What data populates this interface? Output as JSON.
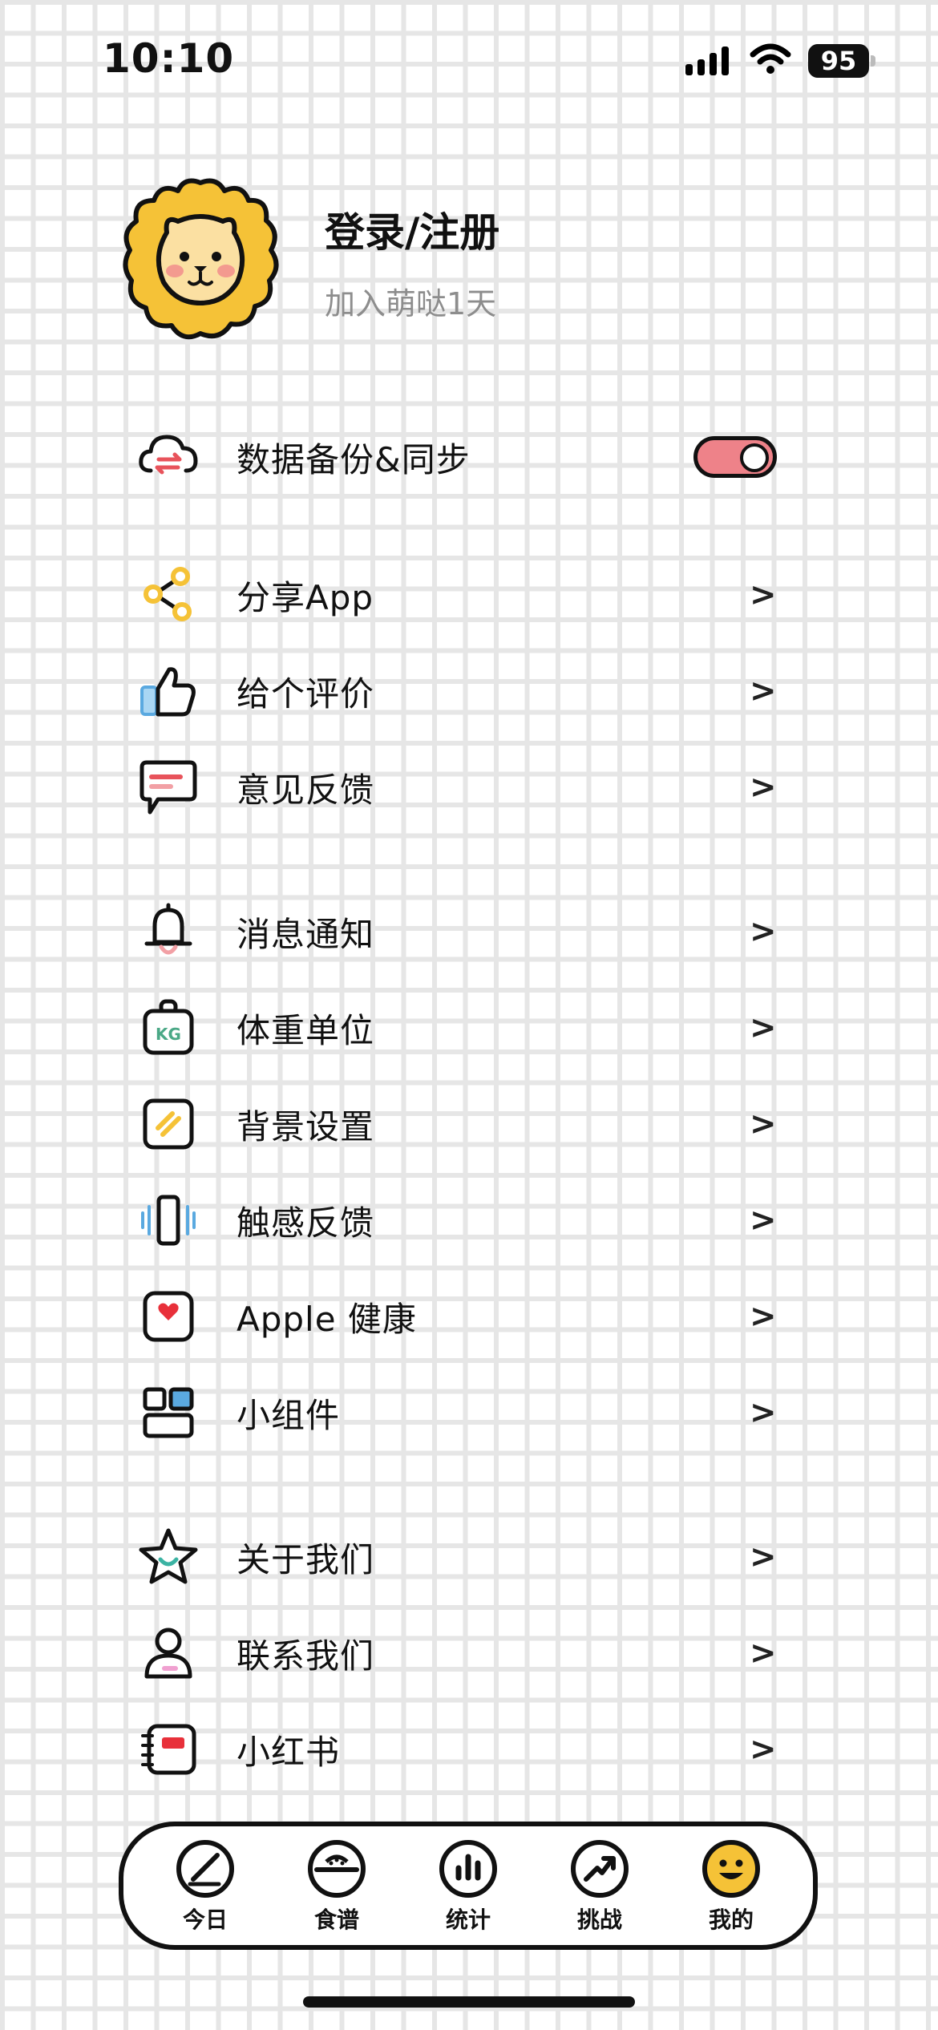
{
  "status_bar": {
    "time": "10:10",
    "battery": "95"
  },
  "profile": {
    "title": "登录/注册",
    "subtitle": "加入萌哒1天",
    "avatar_icon": "lion-avatar-icon"
  },
  "sync": {
    "label": "数据备份&同步",
    "enabled": true,
    "toggle_color": "#ee8289"
  },
  "groups": [
    [
      {
        "id": "share",
        "label": "分享App",
        "icon": "share-icon"
      },
      {
        "id": "rate",
        "label": "给个评价",
        "icon": "thumbs-up-icon"
      },
      {
        "id": "feedback",
        "label": "意见反馈",
        "icon": "chat-bubble-icon"
      }
    ],
    [
      {
        "id": "notify",
        "label": "消息通知",
        "icon": "bell-icon"
      },
      {
        "id": "unit",
        "label": "体重单位",
        "icon": "weight-kg-icon"
      },
      {
        "id": "bg",
        "label": "背景设置",
        "icon": "background-icon"
      },
      {
        "id": "haptic",
        "label": "触感反馈",
        "icon": "vibration-icon"
      },
      {
        "id": "health",
        "label": "Apple 健康",
        "icon": "heart-icon"
      },
      {
        "id": "widget",
        "label": "小组件",
        "icon": "widget-icon"
      }
    ],
    [
      {
        "id": "about",
        "label": "关于我们",
        "icon": "star-icon"
      },
      {
        "id": "contact",
        "label": "联系我们",
        "icon": "person-icon"
      },
      {
        "id": "xhs",
        "label": "小红书",
        "icon": "notebook-icon"
      }
    ]
  ],
  "arrow": ">",
  "tabs": [
    {
      "id": "today",
      "label": "今日",
      "icon": "pen-circle-icon"
    },
    {
      "id": "recipes",
      "label": "食谱",
      "icon": "bowl-icon"
    },
    {
      "id": "stats",
      "label": "统计",
      "icon": "bar-chart-icon"
    },
    {
      "id": "challenge",
      "label": "挑战",
      "icon": "trend-arrow-icon"
    },
    {
      "id": "me",
      "label": "我的",
      "icon": "smiley-icon"
    }
  ],
  "active_tab": "me",
  "colors": {
    "accent_yellow": "#f5c237",
    "accent_pink": "#ee8289",
    "blue": "#5aa9e0"
  }
}
